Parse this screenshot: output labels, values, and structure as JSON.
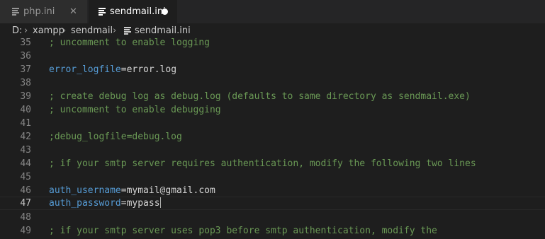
{
  "tabs": [
    {
      "label": "php.ini",
      "close_glyph": "✕",
      "icon": "file-lines-icon"
    },
    {
      "label": "sendmail.ini",
      "icon": "file-lines-icon",
      "dirty": true
    }
  ],
  "breadcrumb": {
    "segments": [
      "D:",
      "xampp",
      "sendmail",
      "sendmail.ini"
    ],
    "separator": "›"
  },
  "editor": {
    "current_line": 47,
    "lines": [
      {
        "number": "35",
        "comment": "; uncomment to enable logging",
        "key": "",
        "op": "",
        "value": ""
      },
      {
        "number": "36",
        "comment": "",
        "key": "",
        "op": "",
        "value": ""
      },
      {
        "number": "37",
        "comment": "",
        "key": "error_logfile",
        "op": "=",
        "value": "error.log"
      },
      {
        "number": "38",
        "comment": "",
        "key": "",
        "op": "",
        "value": ""
      },
      {
        "number": "39",
        "comment": "; create debug log as debug.log (defaults to same directory as sendmail.exe)",
        "key": "",
        "op": "",
        "value": ""
      },
      {
        "number": "40",
        "comment": "; uncomment to enable debugging",
        "key": "",
        "op": "",
        "value": ""
      },
      {
        "number": "41",
        "comment": "",
        "key": "",
        "op": "",
        "value": ""
      },
      {
        "number": "42",
        "comment": ";debug_logfile=debug.log",
        "key": "",
        "op": "",
        "value": ""
      },
      {
        "number": "43",
        "comment": "",
        "key": "",
        "op": "",
        "value": ""
      },
      {
        "number": "44",
        "comment": "; if your smtp server requires authentication, modify the following two lines",
        "key": "",
        "op": "",
        "value": ""
      },
      {
        "number": "45",
        "comment": "",
        "key": "",
        "op": "",
        "value": ""
      },
      {
        "number": "46",
        "comment": "",
        "key": "auth_username",
        "op": "=",
        "value": "mymail@gmail.com"
      },
      {
        "number": "47",
        "comment": "",
        "key": "auth_password",
        "op": "=",
        "value": "mypass"
      },
      {
        "number": "48",
        "comment": "",
        "key": "",
        "op": "",
        "value": ""
      },
      {
        "number": "49",
        "comment": "; if your smtp server uses pop3 before smtp authentication, modify the",
        "key": "",
        "op": "",
        "value": ""
      }
    ]
  },
  "colors": {
    "background": "#1e1e1e",
    "comment": "#6a9955",
    "key": "#569cd6",
    "text": "#d4d4d4"
  }
}
